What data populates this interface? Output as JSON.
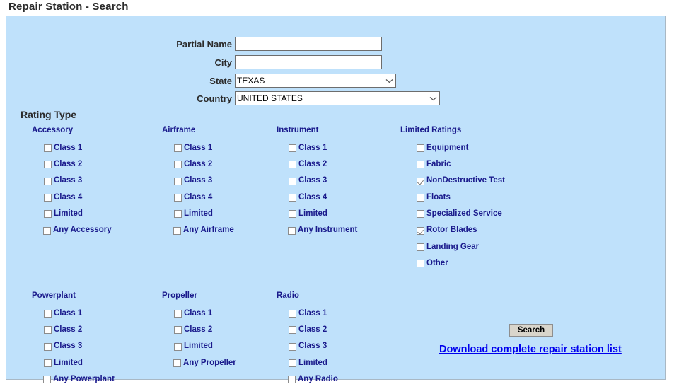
{
  "page": {
    "title": "Repair Station - Search"
  },
  "form": {
    "fields": [
      {
        "label": "Partial Name",
        "value": "",
        "placeholder": "",
        "type": "text"
      },
      {
        "label": "City",
        "value": "",
        "placeholder": "",
        "type": "text"
      },
      {
        "label": "State",
        "value": "TEXAS",
        "type": "select"
      },
      {
        "label": "Country",
        "value": "UNITED STATES",
        "type": "select"
      }
    ]
  },
  "rating_type": {
    "heading": "Rating Type",
    "groups": [
      {
        "name": "Accessory",
        "options": [
          {
            "label": "Class 1",
            "checked": false
          },
          {
            "label": "Class 2",
            "checked": false
          },
          {
            "label": "Class 3",
            "checked": false
          },
          {
            "label": "Class 4",
            "checked": false
          },
          {
            "label": "Limited",
            "checked": false
          },
          {
            "label": "Any Accessory",
            "checked": false
          }
        ]
      },
      {
        "name": "Airframe",
        "options": [
          {
            "label": "Class 1",
            "checked": false
          },
          {
            "label": "Class 2",
            "checked": false
          },
          {
            "label": "Class 3",
            "checked": false
          },
          {
            "label": "Class 4",
            "checked": false
          },
          {
            "label": "Limited",
            "checked": false
          },
          {
            "label": "Any Airframe",
            "checked": false
          }
        ]
      },
      {
        "name": "Instrument",
        "options": [
          {
            "label": "Class 1",
            "checked": false
          },
          {
            "label": "Class 2",
            "checked": false
          },
          {
            "label": "Class 3",
            "checked": false
          },
          {
            "label": "Class 4",
            "checked": false
          },
          {
            "label": "Limited",
            "checked": false
          },
          {
            "label": "Any Instrument",
            "checked": false
          }
        ]
      },
      {
        "name": "Limited Ratings",
        "options": [
          {
            "label": "Equipment",
            "checked": false
          },
          {
            "label": "Fabric",
            "checked": false
          },
          {
            "label": "NonDestructive Test",
            "checked": true
          },
          {
            "label": "Floats",
            "checked": false
          },
          {
            "label": "Specialized Service",
            "checked": false
          },
          {
            "label": "Rotor Blades",
            "checked": true
          },
          {
            "label": "Landing Gear",
            "checked": false
          },
          {
            "label": "Other",
            "checked": false
          }
        ]
      },
      {
        "name": "Powerplant",
        "options": [
          {
            "label": "Class 1",
            "checked": false
          },
          {
            "label": "Class 2",
            "checked": false
          },
          {
            "label": "Class 3",
            "checked": false
          },
          {
            "label": "Limited",
            "checked": false
          },
          {
            "label": "Any Powerplant",
            "checked": false
          }
        ]
      },
      {
        "name": "Propeller",
        "options": [
          {
            "label": "Class 1",
            "checked": false
          },
          {
            "label": "Class 2",
            "checked": false
          },
          {
            "label": "Limited",
            "checked": false
          },
          {
            "label": "Any Propeller",
            "checked": false
          }
        ]
      },
      {
        "name": "Radio",
        "options": [
          {
            "label": "Class 1",
            "checked": false
          },
          {
            "label": "Class 2",
            "checked": false
          },
          {
            "label": "Class 3",
            "checked": false
          },
          {
            "label": "Limited",
            "checked": false
          },
          {
            "label": "Any Radio",
            "checked": false
          }
        ]
      }
    ]
  },
  "actions": {
    "search_label": "Search",
    "download_label": "Download complete repair station list"
  },
  "colors": {
    "panel_background": "#bfe1fb",
    "panel_border": "#a9b8c4",
    "heading_text": "#2b2b2b",
    "group_label": "#1a1a8c",
    "link": "#0000ee",
    "button_face": "#d9d5cb"
  },
  "icons": {
    "chevron_down": "chevron-down-icon",
    "checkmark": "checkmark-icon"
  }
}
